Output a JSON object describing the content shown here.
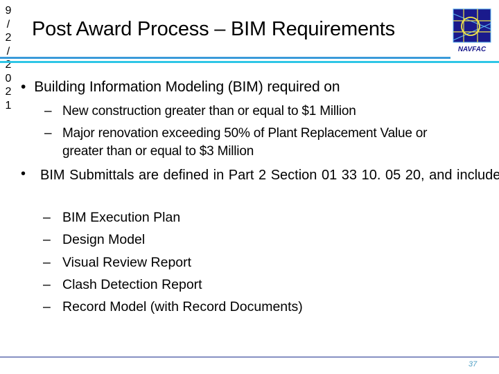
{
  "slide": {
    "date_chars": [
      "9",
      "/",
      "2",
      "/",
      "2",
      "0",
      "2",
      "1"
    ],
    "title": "Post Award Process – BIM Requirements",
    "logo": {
      "name": "navfac-logo",
      "label": "NAVFAC",
      "colors": {
        "background": "#1a1a8c",
        "lines": "#f2e84a",
        "accent": "#5ab4f0"
      }
    },
    "bullets": [
      {
        "marker": "•",
        "text": "Building Information Modeling (BIM) required on",
        "subitems": [
          {
            "marker": "–",
            "text": "New construction greater than or equal to $1 Million"
          },
          {
            "marker": "–",
            "text": "Major renovation exceeding 50% of Plant Replacement Value or",
            "continuation": "greater than or equal to $3 Million"
          }
        ]
      },
      {
        "marker": "•",
        "text": "BIM Submittals are defined in Part 2 Section 01 33 10. 05 20, and include:",
        "subitems": [
          {
            "marker": "–",
            "text": "BIM Execution Plan"
          },
          {
            "marker": "–",
            "text": "Design Model"
          },
          {
            "marker": "–",
            "text": "Visual Review Report"
          },
          {
            "marker": "–",
            "text": "Clash Detection Report"
          },
          {
            "marker": "–",
            "text": "Record Model (with Record Documents)"
          }
        ]
      }
    ],
    "page_number": "37",
    "colors": {
      "rule_top_1": "#3a9ad9",
      "rule_top_2": "#2ec6e6",
      "rule_bottom": "#1a2f8c",
      "page_number": "#4f9fc4"
    }
  }
}
